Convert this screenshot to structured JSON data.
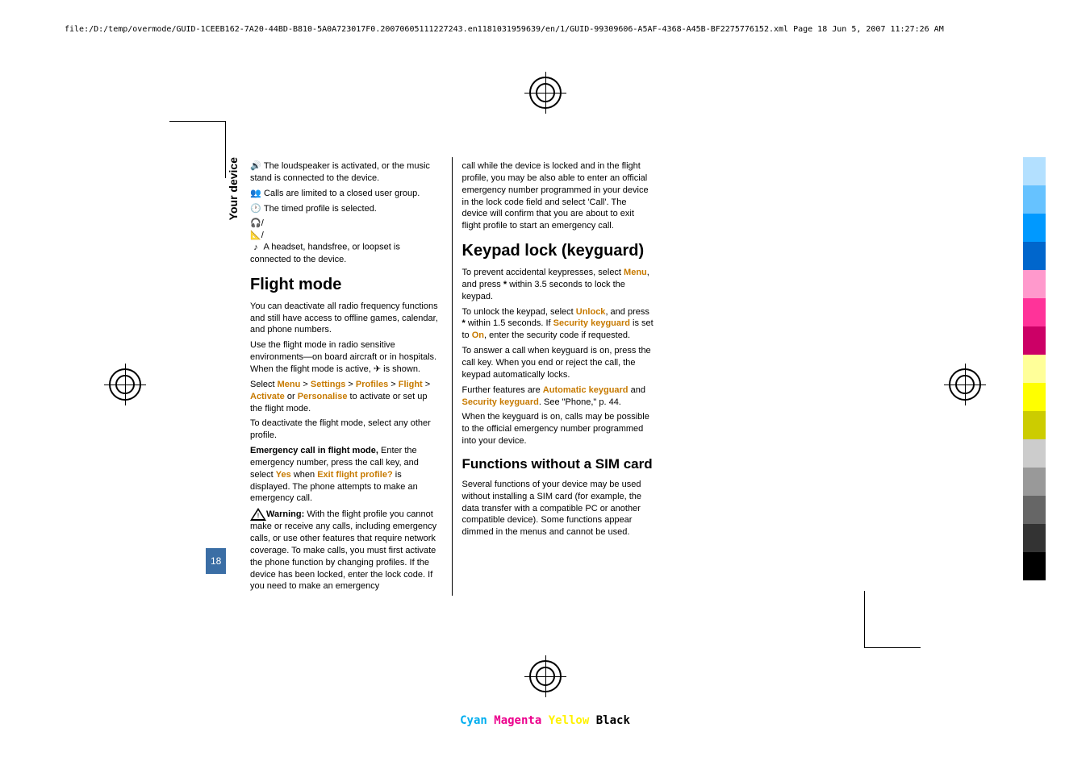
{
  "header": "file:/D:/temp/overmode/GUID-1CEEB162-7A20-44BD-B810-5A0A723017F0.20070605111227243.en1181031959639/en/1/GUID-99309606-A5AF-4368-A45B-BF2275776152.xml    Page  18    Jun 5, 2007 11:27:26 AM",
  "side_label": "Your device",
  "page_num": "18",
  "col1": {
    "p1": "  The loudspeaker is activated, or the music stand is connected to the device.",
    "p2": "  Calls are limited to a closed user group.",
    "p3": "  The timed profile is selected.",
    "p4": "  A headset, handsfree, or loopset is connected to the device.",
    "h1": "Flight mode",
    "p5": "You can deactivate all radio frequency functions and still have access to offline games, calendar, and phone numbers.",
    "p6": "Use the flight mode in radio sensitive environments—on board aircraft or in hospitals. When the flight mode is active, ",
    "p6b": " is shown.",
    "p7a": "Select ",
    "menu": "Menu",
    "gt": " > ",
    "settings": "Settings",
    "profiles": "Profiles",
    "flight": "Flight",
    "activate": "Activate",
    "or": " or ",
    "personalise": "Personalise",
    "p7b": " to activate or set up the flight mode.",
    "p8": "To deactivate the flight mode, select any other profile.",
    "p9a": "Emergency call in flight mode, ",
    "p9b": "Enter the emergency number, press the call key, and select ",
    "yes": "Yes",
    "p9c": " when ",
    "exit": "Exit flight profile?",
    "p9d": " is displayed. The phone attempts to make an emergency call.",
    "warn_label": "Warning:  ",
    "warn": "With the flight profile you cannot make or receive any calls, including emergency calls, or use other features that require network coverage. To make calls, you must first activate the phone function by changing profiles. If the device has been locked, enter the lock code. If you need to make an emergency"
  },
  "col2": {
    "p1": "call while the device is locked and in the flight profile, you may be also able to enter an official emergency number programmed in your device in the lock code field and select 'Call'. The device will confirm that you are about to exit flight profile to start an emergency call.",
    "h1": "Keypad lock (keyguard)",
    "p2a": "To prevent accidental keypresses, select ",
    "menu": "Menu",
    "p2b": ", and press ",
    "star": "*",
    "p2c": " within 3.5 seconds to lock the keypad.",
    "p3a": "To unlock the keypad, select ",
    "unlock": "Unlock",
    "p3b": ", and press ",
    "p3c": " within 1.5 seconds. If ",
    "seckey": "Security keyguard",
    "p3d": " is set to ",
    "on": "On",
    "p3e": ", enter the security code if requested.",
    "p4": "To answer a call when keyguard is on, press the call key. When you end or reject the call, the keypad automatically locks.",
    "p5a": "Further features are ",
    "autokey": "Automatic keyguard",
    "p5b": " and ",
    "p5c": ". See \"Phone,\" p. 44.",
    "p6": "When the keyguard is on, calls may be possible to the official emergency number programmed into your device.",
    "h2": "Functions without a SIM card",
    "p7": "Several functions of your device may be used without installing a SIM card (for example, the data transfer with a compatible PC or another compatible device). Some functions appear dimmed in the menus and cannot be used."
  },
  "footer": {
    "c": "Cyan ",
    "m": "Magenta ",
    "y": "Yellow ",
    "k": "Black"
  },
  "colors": [
    "#b3e0ff",
    "#66c2ff",
    "#0099ff",
    "#0066cc",
    "#ff99cc",
    "#ff3399",
    "#cc0066",
    "#ffff99",
    "#ffff00",
    "#cccc00",
    "#ccc",
    "#999",
    "#666",
    "#333",
    "#000"
  ]
}
